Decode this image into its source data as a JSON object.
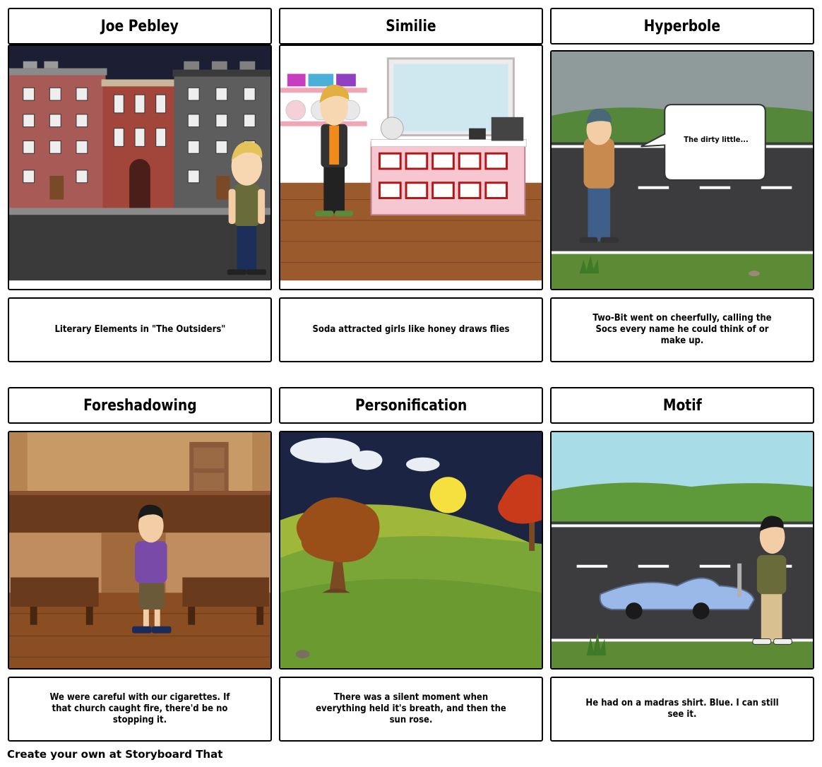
{
  "cells": [
    {
      "title": "Joe Pebley",
      "caption": "Literary Elements in \"The Outsiders\""
    },
    {
      "title": "Similie",
      "caption": "Soda attracted girls like honey draws flies"
    },
    {
      "title": "Hyperbole",
      "caption": "Two-Bit went on cheerfully, calling the Socs every name he could think of or make up.",
      "speech_bubble": "The dirty little..."
    },
    {
      "title": "Foreshadowing",
      "caption": "We were careful with our cigarettes. If that church caught fire, there'd be no stopping it."
    },
    {
      "title": "Personification",
      "caption": "There was a silent moment when everything held it's breath, and then the sun rose."
    },
    {
      "title": "Motif",
      "caption": "He had on a madras shirt. Blue. I can still see it."
    }
  ],
  "footer": "Create your own at Storyboard That"
}
